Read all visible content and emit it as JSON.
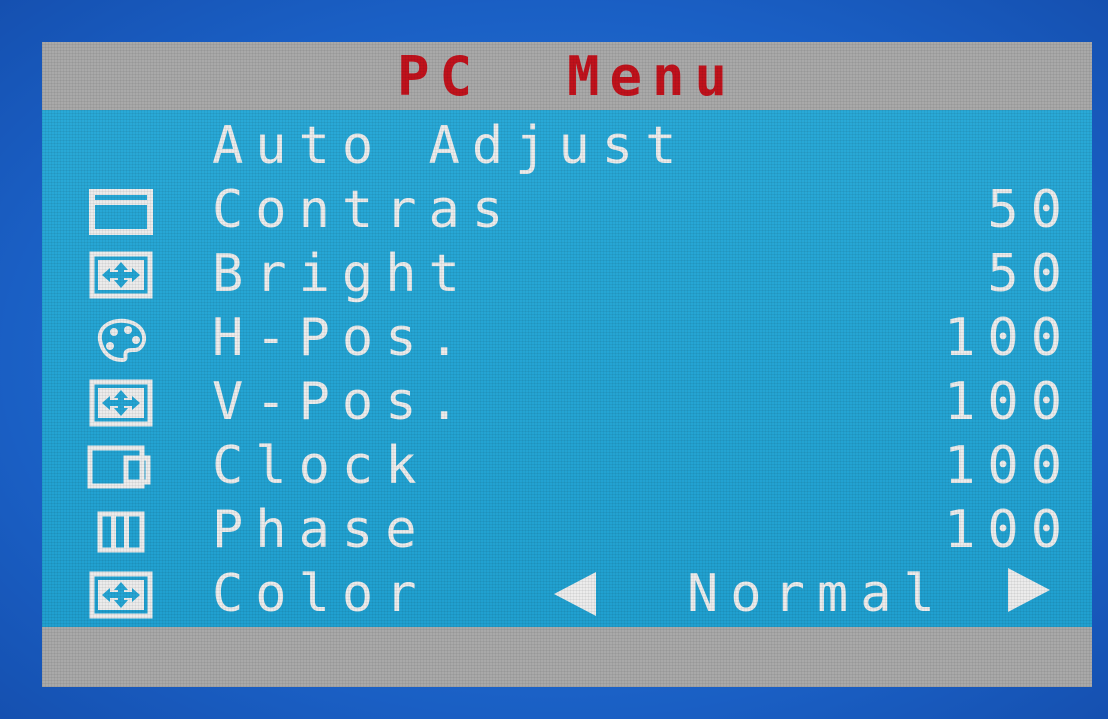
{
  "title": "PC  Menu",
  "colors": {
    "title": "#c1121c",
    "text": "#ececec",
    "panel": "#25a5d4",
    "bar": "#a9a9a9",
    "background": "#1f6fd0"
  },
  "menu": {
    "items": [
      {
        "label": "Auto Adjust",
        "icon": "none",
        "value": ""
      },
      {
        "label": "Contras",
        "icon": "window-icon",
        "value": "50"
      },
      {
        "label": "Bright",
        "icon": "move-arrows-icon",
        "value": "50"
      },
      {
        "label": "H-Pos.",
        "icon": "palette-icon",
        "value": "100"
      },
      {
        "label": "V-Pos.",
        "icon": "move-arrows-icon",
        "value": "100"
      },
      {
        "label": "Clock",
        "icon": "display-icon",
        "value": "100"
      },
      {
        "label": "Phase",
        "icon": "bars-icon",
        "value": "100"
      },
      {
        "label": "Color",
        "icon": "move-arrows-icon",
        "value": "Normal"
      }
    ]
  }
}
